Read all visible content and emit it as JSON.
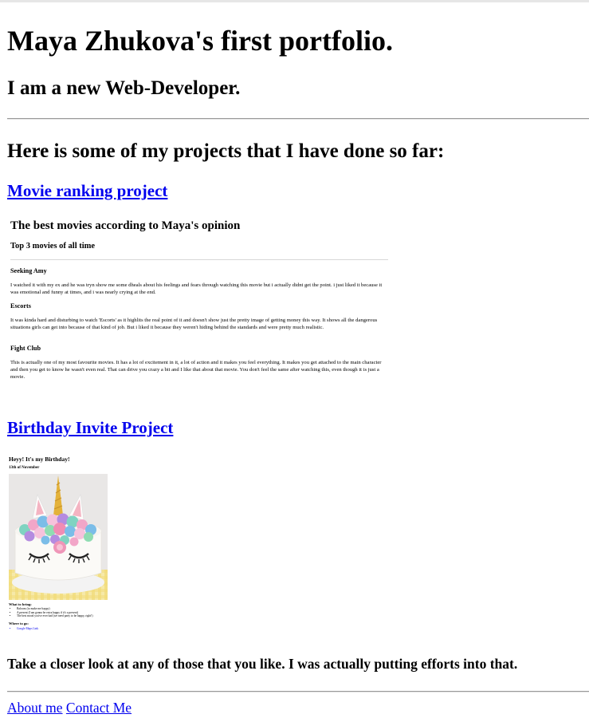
{
  "header": {
    "title": "Maya Zhukova's first portfolio.",
    "subtitle": "I am a new Web-Developer."
  },
  "projects_heading": "Here is some of my projects that I have done so far:",
  "movie_project": {
    "link_label": "Movie ranking project",
    "preview": {
      "title": "The best movies according to Maya's opinion",
      "subtitle": "Top 3 movies of all time",
      "movies": [
        {
          "name": "Seeking Amy",
          "text": "I watched it with my ex and he was tryn show me some dheals about his feelings and fears through watching this movie but i actually didnt get the point. i just liked it because it was emotional and funny at times, and i was nearly crying at the end."
        },
        {
          "name": "Escorts",
          "text": "It was kinda hard and disturbing to watch 'Escorts' as it highlits the real point of it and doesn't show just the pretty image of getting money this way. It shows all the dangerous situations girls can get into because of that kind of job. But i liked it because they weren't hiding behind the standards and were pretty much realistic."
        },
        {
          "name": "Fight Club",
          "text": "This is actually one of my most favourite movies. It has a lot of excitement in it, a lot of action and it makes you feel everything. It makes you get attached to the main character and then you get to know he wasn't even real. That can drive you crazy a bit and I like that about that movie. You don't feel the same after watching this, even though it is just a movie."
        }
      ]
    }
  },
  "birthday_project": {
    "link_label": "Birthday Invite Project",
    "preview": {
      "title": "Heyy! It's my Birthday!",
      "date": "13th of November",
      "what_heading": "What to bring:",
      "what_items": [
        "Baloons (to make me happy)",
        "A present (I am gonna be extra happy if it's a present)",
        "The best mood you've ever had (we need party to be happy, right!)"
      ],
      "where_heading": "Where to go:",
      "where_link": "Google Maps Link"
    }
  },
  "closing_text": "Take a closer look at any of those that you like. I was actually putting efforts into that.",
  "footer": {
    "about_label": "About me",
    "contact_label": "Contact Me"
  },
  "colors": {
    "link": "#0000ee",
    "text": "#000000",
    "background": "#ffffff"
  }
}
